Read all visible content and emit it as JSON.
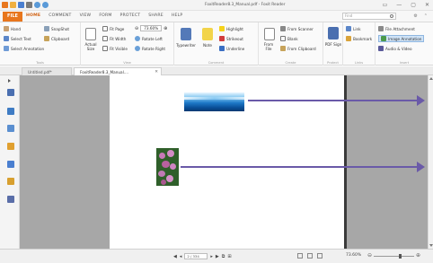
{
  "window": {
    "title": "FoxitReader8.3_Manual.pdf - Foxit Reader",
    "controls": [
      "▭",
      "—",
      "▢",
      "✕"
    ]
  },
  "menu": {
    "file": "FILE",
    "tabs": [
      "HOME",
      "COMMENT",
      "VIEW",
      "FORM",
      "PROTECT",
      "SHARE",
      "HELP"
    ],
    "active_tab": "HOME",
    "find_placeholder": "Find"
  },
  "ribbon": {
    "tools": {
      "label": "Tools",
      "hand": "Hand",
      "select_text": "Select Text",
      "select_annotation": "Select Annotation",
      "snapshot": "SnapShot",
      "clipboard": "Clipboard"
    },
    "view": {
      "label": "View",
      "actual_size": "Actual Size",
      "fit_page": "Fit Page",
      "fit_width": "Fit Width",
      "fit_visible": "Fit Visible",
      "zoom_value": "73.60%",
      "rotate_left": "Rotate Left",
      "rotate_right": "Rotate Right"
    },
    "comment": {
      "label": "Comment",
      "typewriter": "Typewriter",
      "note": "Note",
      "highlight": "Highlight",
      "strikeout": "Strikeout",
      "underline": "Underline"
    },
    "create": {
      "label": "Create",
      "from_file": "From File",
      "from_scanner": "From Scanner",
      "blank": "Blank",
      "from_clipboard": "From Clipboard"
    },
    "protect": {
      "label": "Protect",
      "pdf_sign": "PDF Sign"
    },
    "links": {
      "label": "Links",
      "link": "Link",
      "bookmark": "Bookmark"
    },
    "insert": {
      "label": "Insert",
      "file_attachment": "File Attachment",
      "image_annotation": "Image Annotation",
      "audio_video": "Audio & Video"
    }
  },
  "doc_tabs": [
    {
      "label": "Untitled.pdf*",
      "active": false
    },
    {
      "label": "FoxitReader8.3_Manual....",
      "active": true
    }
  ],
  "statusbar": {
    "page_value": "2 / 334",
    "zoom": "73.60%",
    "zoom_level": 0.62
  },
  "colors": {
    "accent": "#e8761d",
    "arrow": "#6a5aa8",
    "canvas_bg": "#a7a7a7"
  }
}
